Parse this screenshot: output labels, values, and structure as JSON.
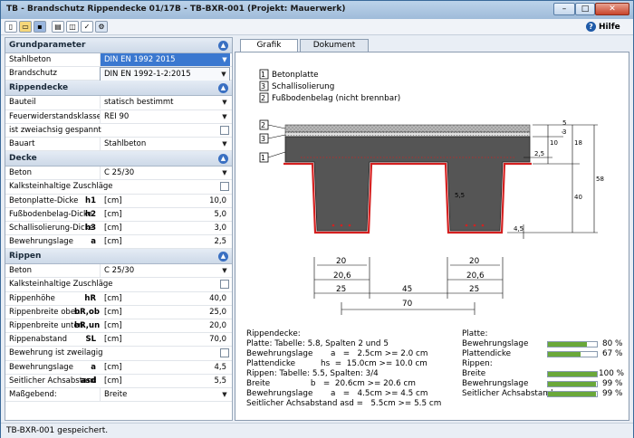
{
  "window": {
    "title": "TB - Brandschutz Rippendecke  01/17B  - TB-BXR-001 (Projekt: Mauerwerk)",
    "minimize": "–",
    "maximize": "□",
    "close": "✕"
  },
  "toolbar": {
    "help_label": "Hilfe",
    "help_icon": "?"
  },
  "sections": {
    "grundparameter": {
      "title": "Grundparameter",
      "collapse": "▲"
    },
    "rippendecke": {
      "title": "Rippendecke",
      "collapse": "▲"
    },
    "decke": {
      "title": "Decke",
      "collapse": "▲"
    },
    "rippen": {
      "title": "Rippen",
      "collapse": "▲"
    }
  },
  "grundparameter": {
    "stahlbeton_label": "Stahlbeton",
    "stahlbeton_value": "DIN EN 1992 2015",
    "brandschutz_label": "Brandschutz",
    "brandschutz_value": "DIN EN 1992-1-2:2015"
  },
  "rippendecke": {
    "bauteil_label": "Bauteil",
    "bauteil_value": "statisch bestimmt",
    "feuer_label": "Feuerwiderstandsklasse:",
    "feuer_value": "REI  90",
    "zweiachsig_label": "ist zweiachsig gespannt",
    "bauart_label": "Bauart",
    "bauart_value": "Stahlbeton"
  },
  "decke": {
    "beton_label": "Beton",
    "beton_value": "C 25/30",
    "kalk_label": "Kalksteinhaltige Zuschläge",
    "betonplatte_label": "Betonplatte-Dicke",
    "betonplatte_sym": "h1",
    "betonplatte_unit": "[cm]",
    "betonplatte_val": "10,0",
    "fussboden_label": "Fußbodenbelag-Dicke",
    "fussboden_sym": "h2",
    "fussboden_unit": "[cm]",
    "fussboden_val": "5,0",
    "schall_label": "Schallisolierung-Dicke",
    "schall_sym": "h3",
    "schall_unit": "[cm]",
    "schall_val": "3,0",
    "bewehr_label": "Bewehrungslage",
    "bewehr_sym": "a",
    "bewehr_unit": "[cm]",
    "bewehr_val": "2,5"
  },
  "rippen": {
    "beton_label": "Beton",
    "beton_value": "C 25/30",
    "kalk_label": "Kalksteinhaltige Zuschläge",
    "hoehe_label": "Rippenhöhe",
    "hoehe_sym": "hR",
    "hoehe_unit": "[cm]",
    "hoehe_val": "40,0",
    "breite_oben_label": "Rippenbreite oben",
    "breite_oben_sym": "bR,ob",
    "breite_oben_unit": "[cm]",
    "breite_oben_val": "25,0",
    "breite_unten_label": "Rippenbreite unten",
    "breite_unten_sym": "bR,un",
    "breite_unten_unit": "[cm]",
    "breite_unten_val": "20,0",
    "abstand_label": "Rippenabstand",
    "abstand_sym": "SL",
    "abstand_unit": "[cm]",
    "abstand_val": "70,0",
    "zweilagig_label": "Bewehrung ist zweilagig",
    "bewehr_label": "Bewehrungslage",
    "bewehr_sym": "a",
    "bewehr_unit": "[cm]",
    "bewehr_val": "4,5",
    "seit_label": "Seitlicher Achsabstand",
    "seit_sym": "asd",
    "seit_unit": "[cm]",
    "seit_val": "5,5",
    "mass_label": "Maßgebend:",
    "mass_value": "Breite"
  },
  "tabs": {
    "grafik": "Grafik",
    "dokument": "Dokument"
  },
  "legend": {
    "items": [
      {
        "num": "1",
        "text": "Betonplatte"
      },
      {
        "num": "3",
        "text": "Schallisolierung"
      },
      {
        "num": "2",
        "text": "Fußbodenbelag (nicht brennbar)"
      }
    ]
  },
  "drawing": {
    "layer_marks": [
      "2",
      "3",
      "1"
    ],
    "dims_right": [
      "2,5",
      "10",
      "3",
      "5",
      "18",
      "40",
      "58",
      "4,5"
    ],
    "dim_inside": "5,5",
    "dims_bottom": [
      "20",
      "20,6",
      "25",
      "20",
      "20,6",
      "25",
      "45",
      "70"
    ]
  },
  "results": {
    "lines": [
      "Rippendecke:",
      "Platte: Tabelle: 5.8, Spalten 2 und 5",
      "Bewehrungslage       a   =   2.5cm >= 2.0 cm",
      "Plattendicke          hs  =  15.0cm >= 10.0 cm",
      "Rippen: Tabelle: 5.5, Spalten: 3/4",
      "Breite                b   =  20.6cm >= 20.6 cm",
      "Bewehrungslage       a   =   4.5cm >= 4.5 cm",
      "Seitlicher Achsabstand asd =   5.5cm >= 5.5 cm"
    ]
  },
  "utilization": {
    "platte_title": "Platte:",
    "rippen_title": "Rippen:",
    "items": [
      {
        "label": "Bewehrungslage",
        "pct": 80,
        "text": "80 %"
      },
      {
        "label": "Plattendicke",
        "pct": 67,
        "text": "67 %"
      },
      {
        "label": "Breite",
        "pct": 100,
        "text": "100 %"
      },
      {
        "label": "Bewehrungslage",
        "pct": 99,
        "text": "99 %"
      },
      {
        "label": "Seitlicher Achsabstand",
        "pct": 99,
        "text": "99 %"
      }
    ]
  },
  "status": {
    "text": "TB-BXR-001 gespeichert."
  },
  "colors": {
    "fire": "#d42020",
    "bar": "#6aa83a",
    "accent": "#3a78d0"
  }
}
